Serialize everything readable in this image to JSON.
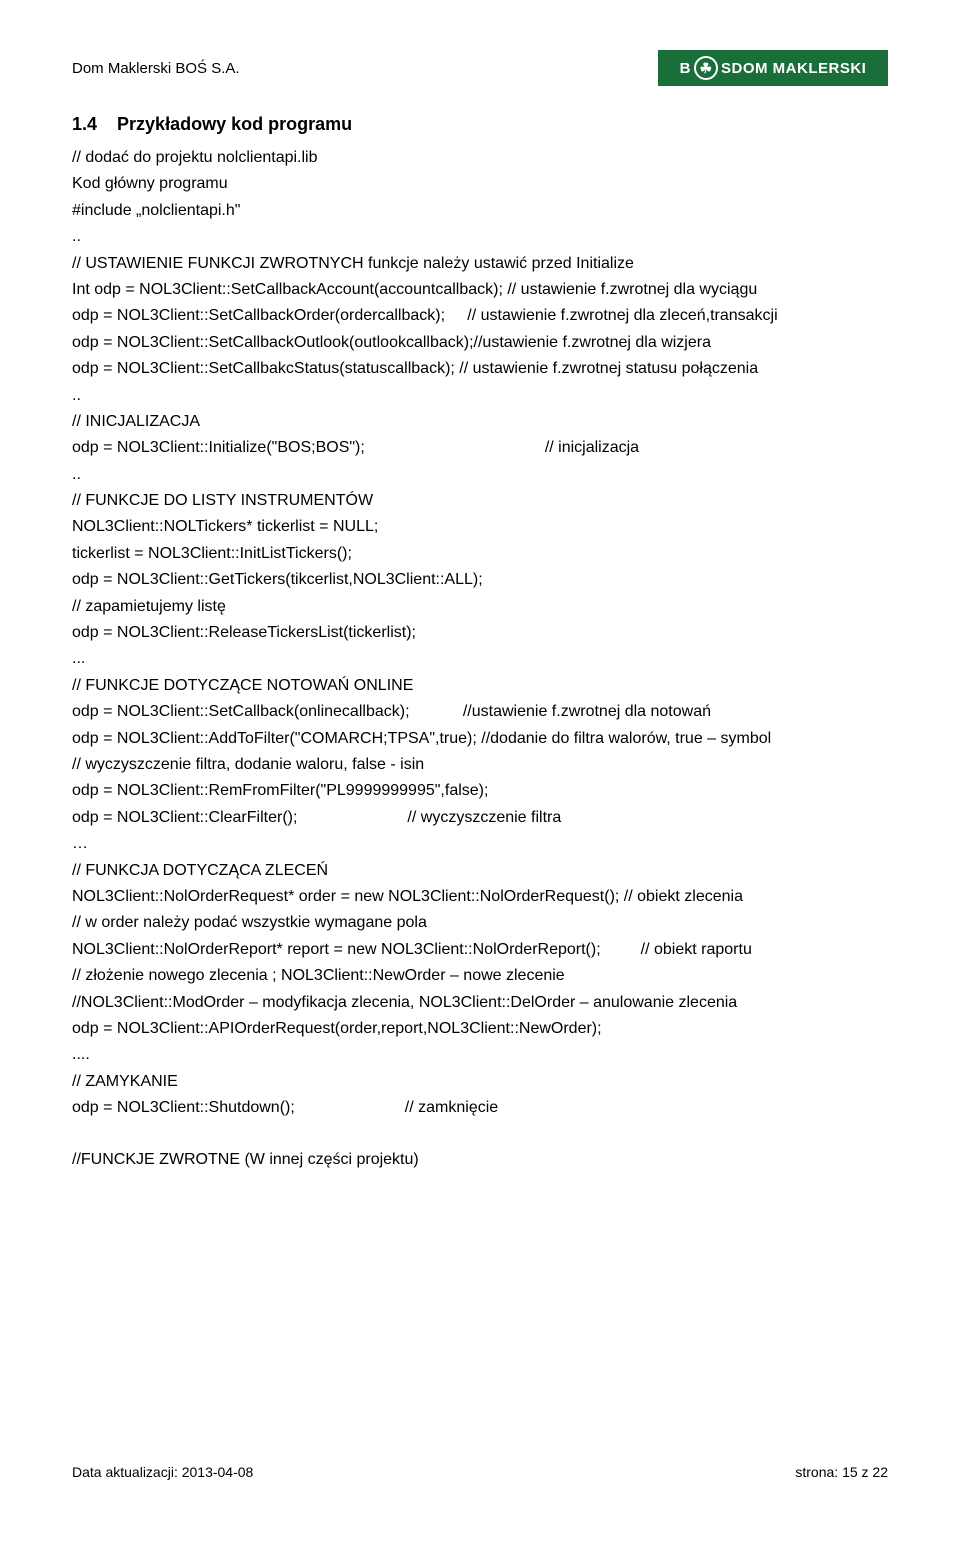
{
  "header": {
    "company": "Dom Maklerski BOŚ S.A.",
    "logo_text_pre": "B",
    "logo_circ": "☘",
    "logo_text_post": "S",
    "logo_text_right": " DOM MAKLERSKI"
  },
  "section": {
    "number": "1.4",
    "title": "Przykładowy kod programu"
  },
  "code": {
    "l01": "// dodać do projektu nolclientapi.lib",
    "l02": "Kod główny programu",
    "l03": "#include „nolclientapi.h\"",
    "l04": "..",
    "l05": "// USTAWIENIE FUNKCJI ZWROTNYCH funkcje należy ustawić przed Initialize",
    "l06": "Int odp = NOL3Client::SetCallbackAccount(accountcallback); // ustawienie f.zwrotnej dla wyciągu",
    "l07a": "odp = NOL3Client::SetCallbackOrder(ordercallback);",
    "l07b": "// ustawienie f.zwrotnej dla zleceń,transakcji",
    "l08": "odp = NOL3Client::SetCallbackOutlook(outlookcallback);//ustawienie f.zwrotnej dla wizjera",
    "l09": "odp = NOL3Client::SetCallbakcStatus(statuscallback);   // ustawienie f.zwrotnej statusu połączenia",
    "l10": "..",
    "l11": "// INICJALIZACJA",
    "l12a": "odp = NOL3Client::Initialize(\"BOS;BOS\");",
    "l12b": "// inicjalizacja",
    "l13": "..",
    "l14": "// FUNKCJE DO LISTY INSTRUMENTÓW",
    "l15": "NOL3Client::NOLTickers* tickerlist = NULL;",
    "l16": "tickerlist = NOL3Client::InitListTickers();",
    "l17": "odp = NOL3Client::GetTickers(tikcerlist,NOL3Client::ALL);",
    "l18": "// zapamietujemy listę",
    "l19": "odp = NOL3Client::ReleaseTickersList(tickerlist);",
    "l20": "...",
    "l21": "// FUNKCJE DOTYCZĄCE NOTOWAŃ ONLINE",
    "l22a": "odp = NOL3Client::SetCallback(onlinecallback);",
    "l22b": "//ustawienie f.zwrotnej dla notowań",
    "l23": "odp = NOL3Client::AddToFilter(\"COMARCH;TPSA\",true); //dodanie do filtra walorów, true – symbol",
    "l24": "// wyczyszczenie filtra, dodanie waloru, false - isin",
    "l25": "odp  = NOL3Client::RemFromFilter(\"PL9999999995\",false);",
    "l26a": "odp = NOL3Client::ClearFilter();",
    "l26b": "// wyczyszczenie filtra",
    "l27": "…",
    "l28": "// FUNKCJA DOTYCZĄCA ZLECEŃ",
    "l29": " NOL3Client::NolOrderRequest* order = new NOL3Client::NolOrderRequest(); // obiekt zlecenia",
    "l30": "// w order należy podać wszystkie wymagane pola",
    "l31a": "NOL3Client::NolOrderReport* report = new NOL3Client::NolOrderReport();",
    "l31b": "// obiekt raportu",
    "l32": "// złożenie nowego zlecenia ; NOL3Client::NewOrder – nowe zlecenie",
    "l33": "//NOL3Client::ModOrder – modyfikacja zlecenia, NOL3Client::DelOrder – anulowanie zlecenia",
    "l34": "odp = NOL3Client::APIOrderRequest(order,report,NOL3Client::NewOrder);",
    "l35": "....",
    "l36": "// ZAMYKANIE",
    "l37a": "odp = NOL3Client::Shutdown();",
    "l37b": "// zamknięcie",
    "l38": "//FUNCKJE ZWROTNE (W innej części projektu)"
  },
  "footer": {
    "left": "Data aktualizacji: 2013-04-08",
    "right": "strona: 15 z 22"
  }
}
